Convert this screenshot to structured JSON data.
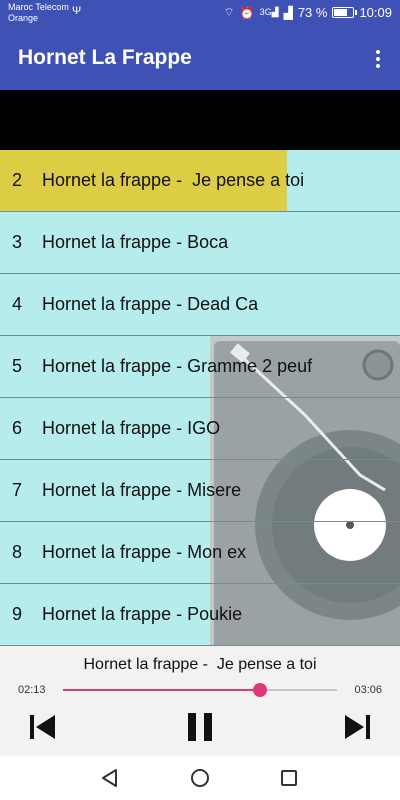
{
  "status_bar": {
    "carrier_line1": "Maroc Telecom",
    "carrier_line2": "Orange",
    "usb_icon": "usb-icon",
    "signal_label": "3G",
    "battery_text": "73 %",
    "battery_level": 0.73,
    "time": "10:09"
  },
  "app_bar": {
    "title": "Hornet La Frappe",
    "menu_icon": "more-vert-icon"
  },
  "tracks": [
    {
      "num": "2",
      "title": "Hornet la frappe -  Je pense a toi",
      "active": true
    },
    {
      "num": "3",
      "title": "Hornet la frappe - Boca"
    },
    {
      "num": "4",
      "title": "Hornet la frappe - Dead Ca"
    },
    {
      "num": "5",
      "title": "Hornet la frappe - Gramme 2 peuf"
    },
    {
      "num": "6",
      "title": "Hornet la frappe - IGO"
    },
    {
      "num": "7",
      "title": "Hornet la frappe - Misere"
    },
    {
      "num": "8",
      "title": "Hornet la frappe - Mon ex"
    },
    {
      "num": "9",
      "title": "Hornet la frappe - Poukie"
    }
  ],
  "player": {
    "now_playing": "Hornet la frappe -  Je pense a toi",
    "current_time": "02:13",
    "total_time": "03:06",
    "progress": 0.72,
    "accent_color": "#e0397a"
  },
  "colors": {
    "primary": "#3f51b5",
    "list_background": "#b7ecec",
    "active_row": "#dccd45"
  }
}
